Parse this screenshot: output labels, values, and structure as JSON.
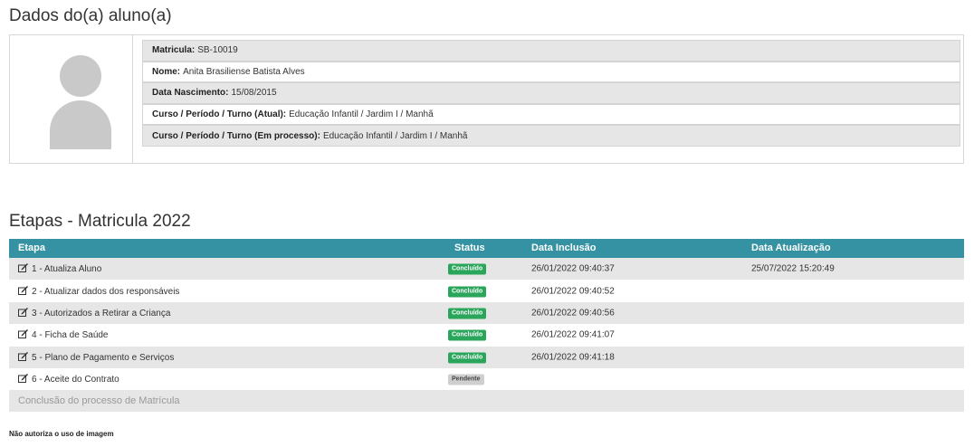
{
  "student_section": {
    "title": "Dados do(a) aluno(a)",
    "rows": [
      {
        "label": "Matricula:",
        "value": "SB-10019"
      },
      {
        "label": "Nome:",
        "value": "Anita Brasiliense Batista Alves"
      },
      {
        "label": "Data Nascimento:",
        "value": "15/08/2015"
      },
      {
        "label": "Curso / Período / Turno (Atual):",
        "value": "Educação Infantil / Jardim I / Manhã"
      },
      {
        "label": "Curso / Período / Turno (Em processo):",
        "value": "Educação Infantil / Jardim I / Manhã"
      }
    ]
  },
  "steps_section": {
    "title": "Etapas - Matricula 2022",
    "headers": {
      "etapa": "Etapa",
      "status": "Status",
      "inclusao": "Data Inclusão",
      "atualizacao": "Data Atualização"
    },
    "rows": [
      {
        "etapa": "1 - Atualiza Aluno",
        "status": "Concluído",
        "inclusao": "26/01/2022 09:40:37",
        "atualizacao": "25/07/2022 15:20:49"
      },
      {
        "etapa": "2 - Atualizar dados dos responsáveis",
        "status": "Concluído",
        "inclusao": "26/01/2022 09:40:52",
        "atualizacao": ""
      },
      {
        "etapa": "3 - Autorizados a Retirar a Criança",
        "status": "Concluído",
        "inclusao": "26/01/2022 09:40:56",
        "atualizacao": ""
      },
      {
        "etapa": "4 - Ficha de Saúde",
        "status": "Concluído",
        "inclusao": "26/01/2022 09:41:07",
        "atualizacao": ""
      },
      {
        "etapa": "5 - Plano de Pagamento e Serviços",
        "status": "Concluído",
        "inclusao": "26/01/2022 09:41:18",
        "atualizacao": ""
      },
      {
        "etapa": "6 - Aceite do Contrato",
        "status": "Pendente",
        "inclusao": "",
        "atualizacao": ""
      }
    ],
    "final_label": "Conclusão do processo de Matrícula"
  },
  "footer": {
    "note": "Não autoriza o uso de imagem"
  },
  "colors": {
    "header_bg": "#3592a3",
    "done_badge": "#2aa65b",
    "pending_badge": "#cfcfcf",
    "odd_row": "#e6e6e6"
  },
  "icons": {
    "edit": "edit-icon",
    "avatar": "user-avatar-placeholder"
  }
}
